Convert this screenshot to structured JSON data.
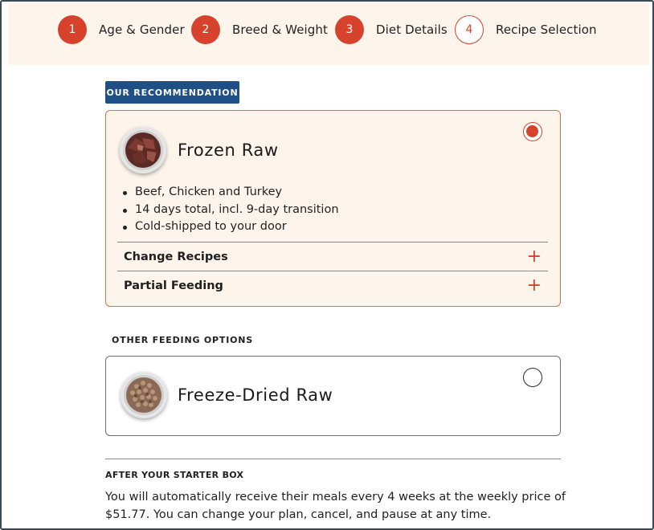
{
  "stepper": {
    "steps": [
      {
        "number": "1",
        "label": "Age & Gender",
        "state": "complete"
      },
      {
        "number": "2",
        "label": "Breed & Weight",
        "state": "complete"
      },
      {
        "number": "3",
        "label": "Diet Details",
        "state": "complete"
      },
      {
        "number": "4",
        "label": "Recipe Selection",
        "state": "current"
      }
    ]
  },
  "recommendation": {
    "badge": "OUR RECOMMENDATION",
    "title": "Frozen Raw",
    "selected": true,
    "image_icon": "raw-meat-bowl",
    "bullets": [
      "Beef, Chicken and Turkey",
      "14 days total, incl. 9-day transition",
      "Cold-shipped to your door"
    ],
    "change_recipes_label": "Change Recipes",
    "partial_feeding_label": "Partial Feeding",
    "expand_icon": "+"
  },
  "other_options": {
    "section_label": "OTHER FEEDING OPTIONS",
    "options": [
      {
        "title": "Freeze-Dried Raw",
        "selected": false,
        "image_icon": "kibble-bowl"
      }
    ]
  },
  "after_starter": {
    "label": "AFTER YOUR STARTER BOX",
    "text": "You will automatically receive their meals every 4 weeks at the weekly price of $51.77. You can change your plan, cancel, and pause at any time."
  },
  "colors": {
    "accent": "#d6422b",
    "badge_bg": "#1e4f86",
    "cream": "#fdf5ec"
  }
}
